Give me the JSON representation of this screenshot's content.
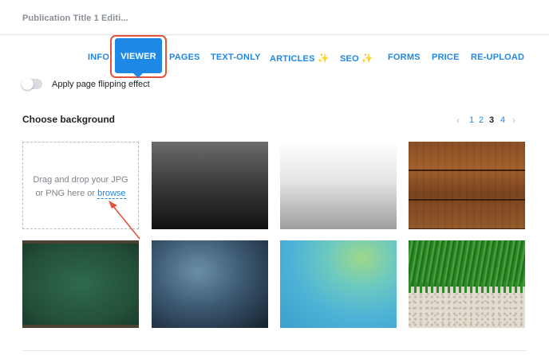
{
  "header": {
    "title": "Publication Title 1 Editi..."
  },
  "tabs": [
    {
      "label": "INFO",
      "sparkle": false
    },
    {
      "label": "VIEWER",
      "sparkle": false,
      "active": true
    },
    {
      "label": "PAGES",
      "sparkle": false
    },
    {
      "label": "TEXT-ONLY",
      "sparkle": false
    },
    {
      "label": "ARTICLES",
      "sparkle": true
    },
    {
      "label": "SEO",
      "sparkle": true
    },
    {
      "label": "FORMS",
      "sparkle": false
    },
    {
      "label": "PRICE",
      "sparkle": false
    },
    {
      "label": "RE-UPLOAD",
      "sparkle": false
    }
  ],
  "sparkle_glyph": "✨",
  "toggle": {
    "label": "Apply page flipping effect",
    "on": false
  },
  "background": {
    "title": "Choose background",
    "pager": {
      "prev": "‹",
      "pages": [
        "1",
        "2",
        "3",
        "4"
      ],
      "current": "3",
      "next": "›"
    },
    "dropzone": {
      "line1": "Drag and drop your JPG",
      "line2_prefix": "or PNG here or ",
      "browse_label": "browse"
    },
    "tiles": [
      {
        "name": "dark-gradient"
      },
      {
        "name": "light-gradient"
      },
      {
        "name": "wood"
      },
      {
        "name": "chalkboard"
      },
      {
        "name": "blue-texture"
      },
      {
        "name": "aqua-watercolor"
      },
      {
        "name": "grass-sand"
      }
    ]
  },
  "colors": {
    "accent": "#1e88e5",
    "highlight": "#e2543b",
    "sparkle": "#f4c430"
  }
}
